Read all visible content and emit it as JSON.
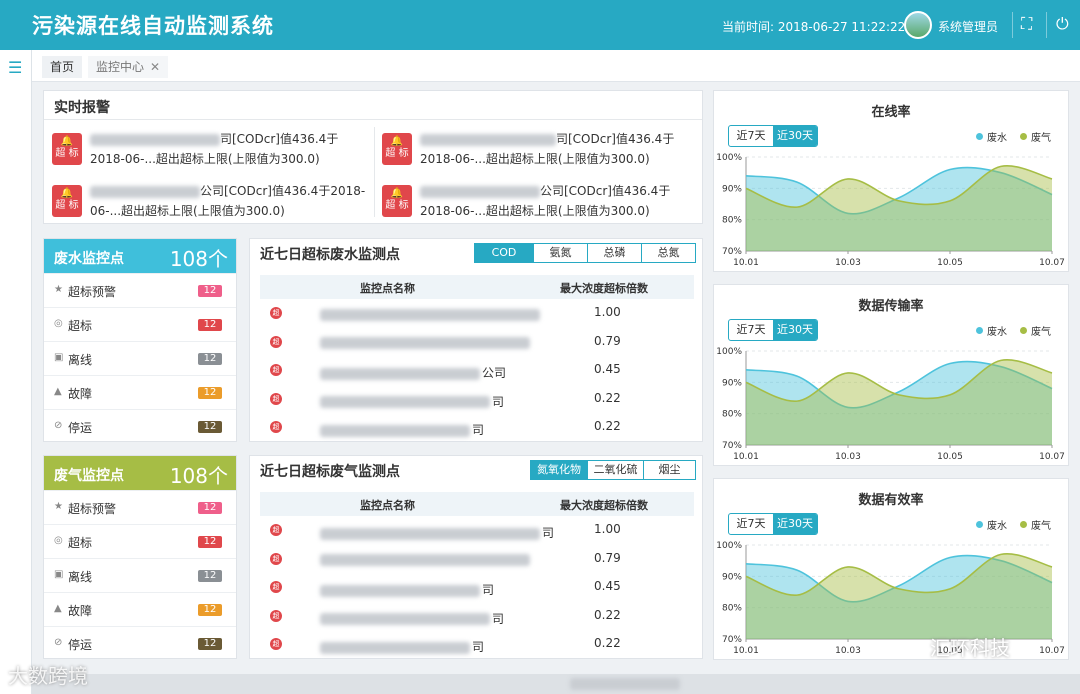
{
  "header": {
    "title": "污染源在线自动监测系统",
    "time_label": "当前时间: 2018-06-27 11:22:22",
    "user": "系统管理员"
  },
  "tabs": [
    {
      "label": "首页"
    },
    {
      "label": "监控中心"
    }
  ],
  "alarm": {
    "title": "实时报警",
    "badge": "超 标",
    "items": [
      {
        "text": "司[CODcr]值436.4于2018-06-...超出超标上限(上限值为300.0)"
      },
      {
        "text": "司[CODcr]值436.4于2018-06-...超出超标上限(上限值为300.0)"
      },
      {
        "text": "公司[CODcr]值436.4于2018-06-...超出超标上限(上限值为300.0)"
      },
      {
        "text": "公司[CODcr]值436.4于2018-06-...超出超标上限(上限值为300.0)"
      }
    ]
  },
  "water_stat": {
    "name": "废水监控点",
    "count": "108个",
    "rows": [
      {
        "label": "超标预警",
        "count": "12",
        "color": "#ef5f8a"
      },
      {
        "label": "超标",
        "count": "12",
        "color": "#e0474b"
      },
      {
        "label": "离线",
        "count": "12",
        "color": "#8a8f94"
      },
      {
        "label": "故障",
        "count": "12",
        "color": "#eb9c2a"
      },
      {
        "label": "停运",
        "count": "12",
        "color": "#6a5a35"
      }
    ]
  },
  "gas_stat": {
    "name": "废气监控点",
    "count": "108个",
    "rows": [
      {
        "label": "超标预警",
        "count": "12",
        "color": "#ef5f8a"
      },
      {
        "label": "超标",
        "count": "12",
        "color": "#e0474b"
      },
      {
        "label": "离线",
        "count": "12",
        "color": "#8a8f94"
      },
      {
        "label": "故障",
        "count": "12",
        "color": "#eb9c2a"
      },
      {
        "label": "停运",
        "count": "12",
        "color": "#6a5a35"
      }
    ]
  },
  "water_table": {
    "title": "近七日超标废水监测点",
    "buttons": [
      "COD",
      "氨氮",
      "总磷",
      "总氮"
    ],
    "col_name": "监控点名称",
    "col_val": "最大浓度超标倍数",
    "dot": "超",
    "rows": [
      {
        "name": "",
        "value": "1.00"
      },
      {
        "name": "",
        "value": "0.79"
      },
      {
        "name": "公司",
        "value": "0.45"
      },
      {
        "name": "司",
        "value": "0.22"
      },
      {
        "name": "司",
        "value": "0.22"
      }
    ]
  },
  "gas_table": {
    "title": "近七日超标废气监测点",
    "buttons": [
      "氮氧化物",
      "二氧化硫",
      "烟尘"
    ],
    "col_name": "监控点名称",
    "col_val": "最大浓度超标倍数",
    "dot": "超",
    "rows": [
      {
        "name": "司",
        "value": "1.00"
      },
      {
        "name": "",
        "value": "0.79"
      },
      {
        "name": "司",
        "value": "0.45"
      },
      {
        "name": "司",
        "value": "0.22"
      },
      {
        "name": "司",
        "value": "0.22"
      }
    ]
  },
  "charts_ui": {
    "btn7": "近7天",
    "btn30": "近30天",
    "legend_water": "废水",
    "legend_gas": "废气"
  },
  "colors": {
    "accent": "#27a9c3",
    "water": "#4ec3dc",
    "gas": "#a6bd45"
  },
  "watermark": {
    "left": "大数跨境",
    "right": "汇环科技"
  },
  "chart_data": [
    {
      "type": "area",
      "title": "在线率",
      "x": [
        "10.01",
        "10.02",
        "10.03",
        "10.04",
        "10.05",
        "10.06",
        "10.07"
      ],
      "xticks": [
        "10.01",
        "10.03",
        "10.05",
        "10.07"
      ],
      "yticks": [
        "100%",
        "90%",
        "80%",
        "70%"
      ],
      "ylim": [
        70,
        100
      ],
      "series": [
        {
          "name": "废水",
          "values": [
            94,
            92,
            82,
            87,
            96,
            95,
            88
          ]
        },
        {
          "name": "废气",
          "values": [
            90,
            84,
            93,
            86,
            86,
            97,
            93
          ]
        }
      ]
    },
    {
      "type": "area",
      "title": "数据传输率",
      "x": [
        "10.01",
        "10.02",
        "10.03",
        "10.04",
        "10.05",
        "10.06",
        "10.07"
      ],
      "xticks": [
        "10.01",
        "10.03",
        "10.05",
        "10.07"
      ],
      "yticks": [
        "100%",
        "90%",
        "80%",
        "70%"
      ],
      "ylim": [
        70,
        100
      ],
      "series": [
        {
          "name": "废水",
          "values": [
            94,
            92,
            82,
            87,
            96,
            95,
            88
          ]
        },
        {
          "name": "废气",
          "values": [
            90,
            84,
            93,
            86,
            86,
            97,
            93
          ]
        }
      ]
    },
    {
      "type": "area",
      "title": "数据有效率",
      "x": [
        "10.01",
        "10.02",
        "10.03",
        "10.04",
        "10.05",
        "10.06",
        "10.07"
      ],
      "xticks": [
        "10.01",
        "10.03",
        "10.05",
        "10.07"
      ],
      "yticks": [
        "100%",
        "90%",
        "80%",
        "70%"
      ],
      "ylim": [
        70,
        100
      ],
      "series": [
        {
          "name": "废水",
          "values": [
            94,
            92,
            82,
            87,
            96,
            95,
            88
          ]
        },
        {
          "name": "废气",
          "values": [
            90,
            84,
            93,
            86,
            86,
            97,
            93
          ]
        }
      ]
    }
  ]
}
